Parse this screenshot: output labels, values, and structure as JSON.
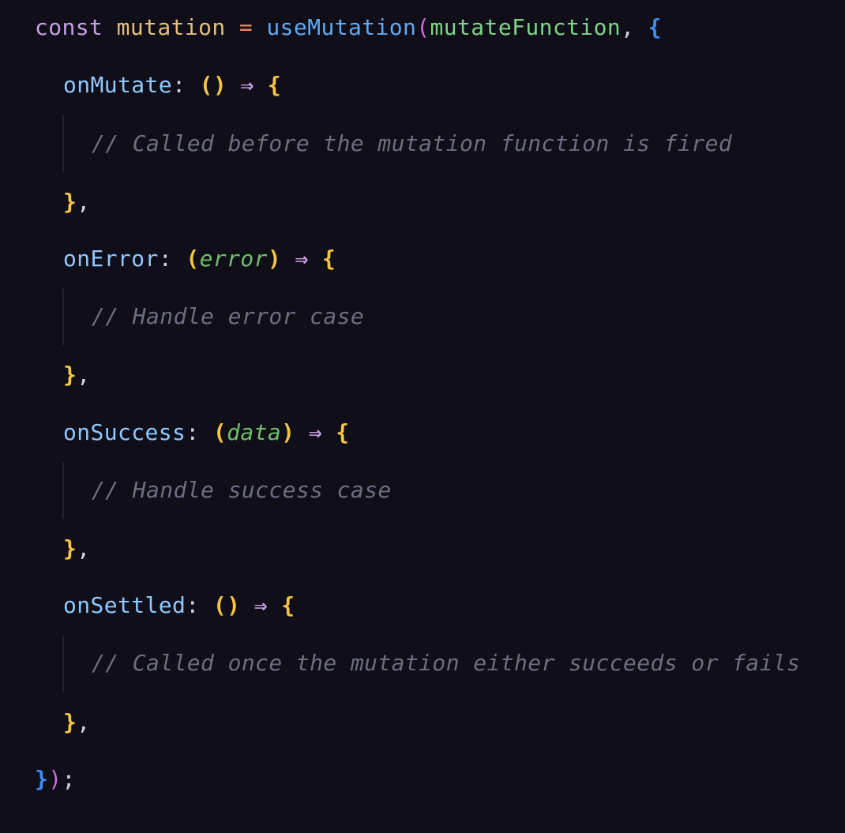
{
  "code": {
    "line1": {
      "kw_const": "const",
      "var_name": "mutation",
      "op_assign": "=",
      "fn_name": "useMutation",
      "open_paren": "(",
      "arg_name": "mutateFunction",
      "comma": ",",
      "open_brace": "{"
    },
    "on_mutate": {
      "prop": "onMutate",
      "colon": ":",
      "params_open": "(",
      "param": "",
      "params_close": ")",
      "arrow": "⇒",
      "open_brace": "{",
      "comment": "// Called before the mutation function is fired",
      "close_brace": "}",
      "close_comma": ","
    },
    "on_error": {
      "prop": "onError",
      "colon": ":",
      "params_open": "(",
      "param": "error",
      "params_close": ")",
      "arrow": "⇒",
      "open_brace": "{",
      "comment": "// Handle error case",
      "close_brace": "}",
      "close_comma": ","
    },
    "on_success": {
      "prop": "onSuccess",
      "colon": ":",
      "params_open": "(",
      "param": "data",
      "params_close": ")",
      "arrow": "⇒",
      "open_brace": "{",
      "comment": "// Handle success case",
      "close_brace": "}",
      "close_comma": ","
    },
    "on_settled": {
      "prop": "onSettled",
      "colon": ":",
      "params_open": "(",
      "param": "",
      "params_close": ")",
      "arrow": "⇒",
      "open_brace": "{",
      "comment": "// Called once the mutation either succeeds or fails",
      "close_brace": "}",
      "close_comma": ","
    },
    "last_line": {
      "close_brace": "}",
      "close_paren": ")",
      "semicolon": ";"
    }
  }
}
